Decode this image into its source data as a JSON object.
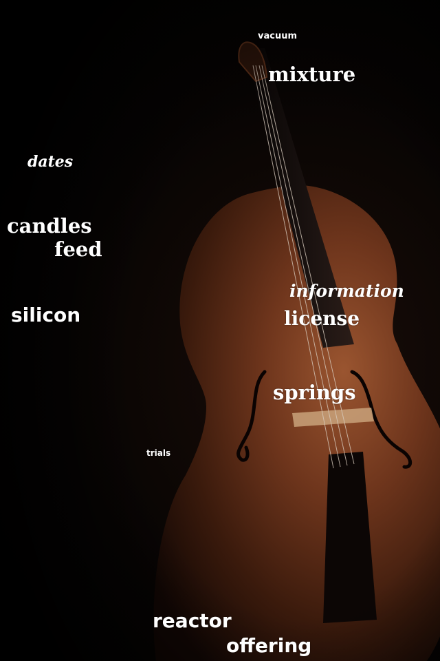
{
  "image": {
    "subject": "cello-icon",
    "background_color": "#000000",
    "wood_color": "#7a3e22",
    "text_color": "#ffffff"
  },
  "words": {
    "vacuum": "vacuum",
    "mixture": "mixture",
    "dates": "dates",
    "candles": "candles",
    "feed": "feed",
    "information": "information",
    "silicon": "silicon",
    "license": "license",
    "springs": "springs",
    "trials": "trials",
    "reactor": "reactor",
    "offering": "offering"
  }
}
